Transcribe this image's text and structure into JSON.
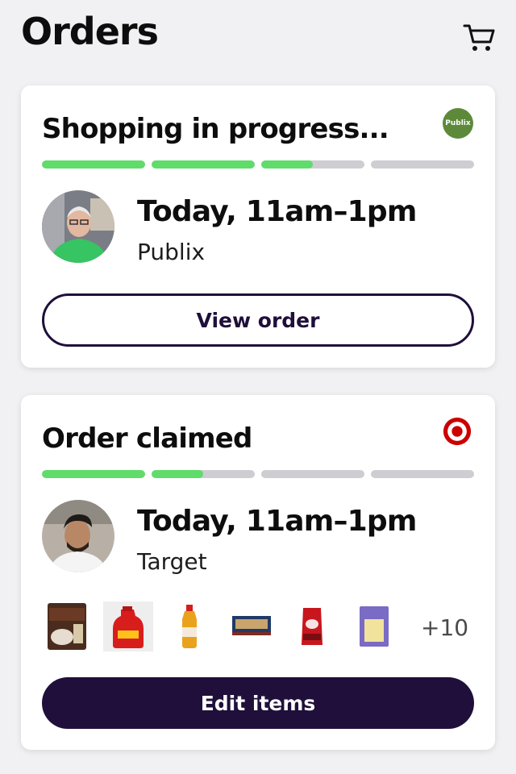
{
  "header": {
    "title": "Orders",
    "cart_icon": "cart-icon"
  },
  "orders": [
    {
      "status": "Shopping in progress...",
      "store_logo_text": "Publix",
      "store_logo_color": "#5c8a3a",
      "progress": [
        1.0,
        1.0,
        0.5,
        0.0
      ],
      "time_window": "Today, 11am–1pm",
      "store": "Publix",
      "action_label": "View order"
    },
    {
      "status": "Order claimed",
      "store_logo_color": "#cc0000",
      "progress": [
        1.0,
        0.5,
        0.0,
        0.0
      ],
      "time_window": "Today, 11am–1pm",
      "store": "Target",
      "items": [
        "coffee-pods-box",
        "red-jug",
        "oil-bottle",
        "snack-box",
        "red-bag",
        "purple-package"
      ],
      "more_items": "+10",
      "action_label": "Edit items"
    }
  ],
  "colors": {
    "progress_fill": "#5fdc6a",
    "progress_track": "#cdcdd2",
    "brand_dark": "#1f0f3a"
  }
}
